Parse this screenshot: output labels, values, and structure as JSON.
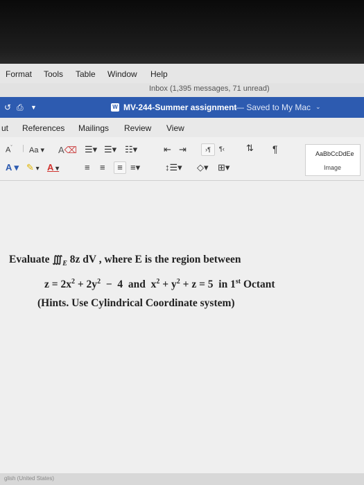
{
  "menubar": {
    "items": [
      "Format",
      "Tools",
      "Table",
      "Window",
      "Help"
    ]
  },
  "mail_status": "Inbox (1,395 messages, 71 unread)",
  "titlebar": {
    "doc_name": "MV-244-Summer assignment",
    "saved_status": "— Saved to My Mac"
  },
  "ribbon_tabs": [
    "ut",
    "References",
    "Mailings",
    "Review",
    "View"
  ],
  "ribbon": {
    "font_size_label": "Aa",
    "style_preview": "AaBbCcDdEe",
    "style_name": "Image"
  },
  "problem": {
    "line1_a": "Evaluate",
    "integral": "∭",
    "sub_e": "E",
    "line1_b": "8z dV ,",
    "line1_c": "where E is the region between",
    "line2_a": "z = 2x",
    "sq1": "2",
    "line2_b": " + 2y",
    "sq2": "2",
    "line2_c": "  −  4  and  x",
    "sq3": "2",
    "line2_d": " + y",
    "sq4": "2",
    "line2_e": " + z = 5  in 1",
    "sup_st": "st",
    "line2_f": " Octant",
    "hint": "(Hints. Use Cylindrical Coordinate system)"
  },
  "status_lang": "glish (United States)",
  "colors": {
    "title_blue": "#2d5bb0",
    "font_red": "#d0312d"
  }
}
